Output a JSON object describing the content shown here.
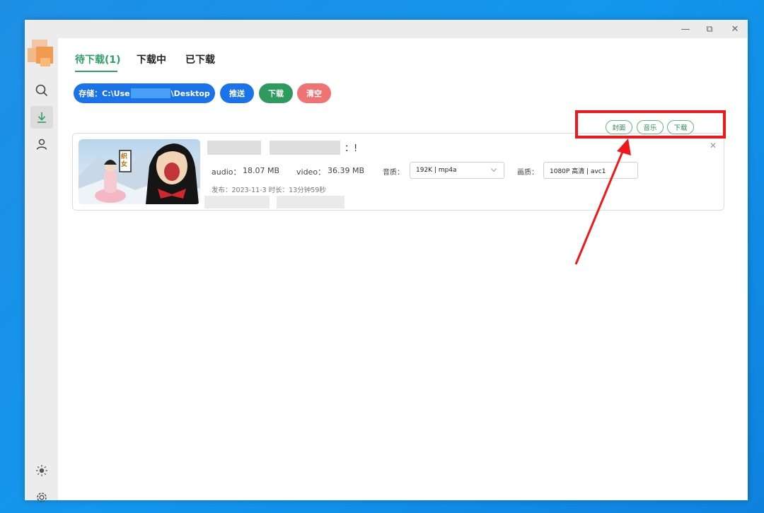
{
  "window": {
    "controls": {
      "minimize": "—",
      "restore": "⧉",
      "close": "✕"
    }
  },
  "sidebar": {
    "items": [
      {
        "name": "search",
        "active": false
      },
      {
        "name": "download",
        "active": true
      },
      {
        "name": "user",
        "active": false
      }
    ]
  },
  "tabs": [
    {
      "label": "待下载(1)",
      "active": true
    },
    {
      "label": "下载中",
      "active": false
    },
    {
      "label": "已下载",
      "active": false
    }
  ],
  "toolbar": {
    "storage_prefix": "存储：C:\\Use",
    "storage_suffix": "\\Desktop",
    "push_label": "推送",
    "download_label": "下载",
    "clear_label": "清空"
  },
  "item": {
    "title_suffix": "：!",
    "audio_label": "audio：",
    "audio_size": "18.07 MB",
    "video_label": "video：",
    "video_size": "36.39 MB",
    "audio_quality_label": "音质：",
    "audio_quality_value": "192K | mp4a",
    "video_quality_label": "画质：",
    "video_quality_value": "1080P 高清 | avc1",
    "publish_info": "发布：2023-11-3 时长：13分钟59秒",
    "thumbnail_badge": "织女",
    "actions": {
      "cover_label": "封面",
      "music_label": "音乐",
      "download_label": "下载",
      "close_label": "✕"
    }
  },
  "colors": {
    "accent_green": "#2e9e66",
    "button_blue": "#1a73e8",
    "button_pink": "#f07373",
    "highlight_red": "#f01818"
  }
}
